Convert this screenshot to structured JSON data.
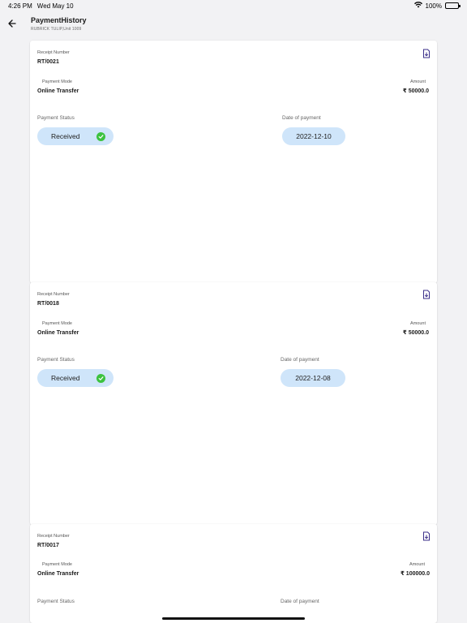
{
  "status_bar": {
    "time": "4:26 PM",
    "date": "Wed May 10",
    "battery": "100%"
  },
  "header": {
    "title": "PaymentHistory",
    "subtitle": "RUBRICK TULIP,Unit 1009"
  },
  "labels": {
    "receipt_number": "Receipt Number",
    "payment_mode": "Payment Mode",
    "amount": "Amount",
    "payment_status": "Payment Status",
    "date_of_payment": "Date of payment"
  },
  "receipts": [
    {
      "receipt_number": "RT/0021",
      "payment_mode": "Online Transfer",
      "amount": "₹ 50000.0",
      "status": "Received",
      "date": "2022-12-10"
    },
    {
      "receipt_number": "RT/0018",
      "payment_mode": "Online Transfer",
      "amount": "₹ 50000.0",
      "status": "Received",
      "date": "2022-12-08"
    },
    {
      "receipt_number": "RT/0017",
      "payment_mode": "Online Transfer",
      "amount": "₹ 100000.0"
    }
  ],
  "colors": {
    "pill": "#cfe5fa",
    "check": "#3cc23f",
    "download_icon": "#3b2f8a"
  }
}
